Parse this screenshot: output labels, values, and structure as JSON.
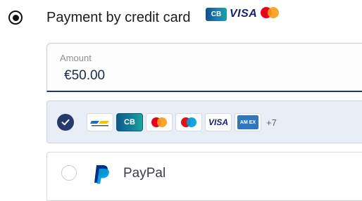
{
  "payment_method": {
    "label": "Payment by credit card",
    "selected": true,
    "header_logos": [
      "cb-logo",
      "visa-logo",
      "mastercard-logo"
    ],
    "header_logo_texts": {
      "cb": "CB",
      "visa": "VISA"
    }
  },
  "amount": {
    "label": "Amount",
    "value": "€50.00"
  },
  "card_option": {
    "selected": true,
    "brands": [
      "bancontact",
      "cb",
      "mastercard",
      "maestro",
      "visa",
      "amex"
    ],
    "brand_texts": {
      "cb": "CB",
      "visa": "VISA",
      "amex": "AM EX"
    },
    "more_count": "+7"
  },
  "paypal_option": {
    "label": "PayPal",
    "selected": false
  },
  "colors": {
    "accent": "#253a6b",
    "selected_bg": "#e9edf5",
    "mastercard_red": "#eb001b",
    "mastercard_orange": "#f79e1b",
    "visa_blue": "#1a1f71",
    "paypal_dark": "#003087",
    "paypal_light": "#009cde"
  }
}
